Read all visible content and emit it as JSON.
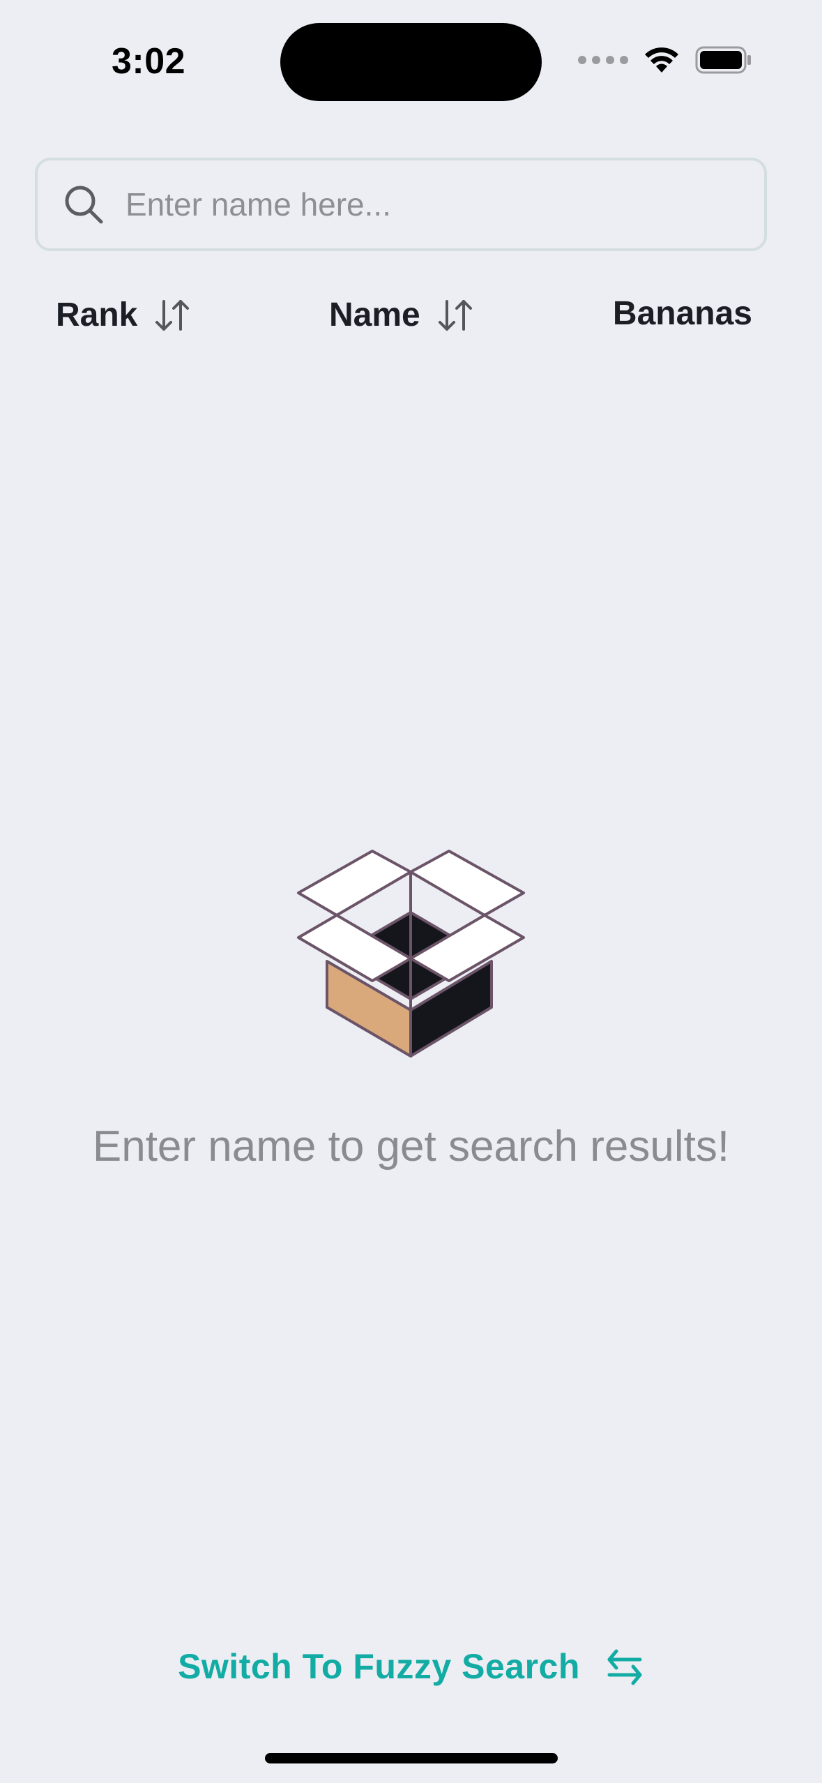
{
  "status_bar": {
    "time": "3:02"
  },
  "search": {
    "placeholder": "Enter name here...",
    "value": ""
  },
  "columns": {
    "rank": "Rank",
    "name": "Name",
    "bananas": "Bananas"
  },
  "empty_state": {
    "icon": "open-box-icon",
    "message": "Enter name to get search results!"
  },
  "footer": {
    "switch_label": "Switch To Fuzzy Search",
    "switch_icon": "swap-arrows-icon"
  },
  "colors": {
    "background": "#edeef3",
    "accent": "#12aca4",
    "text_primary": "#1c1e26",
    "text_muted": "#8a8b90",
    "search_border": "#d4dde0"
  }
}
